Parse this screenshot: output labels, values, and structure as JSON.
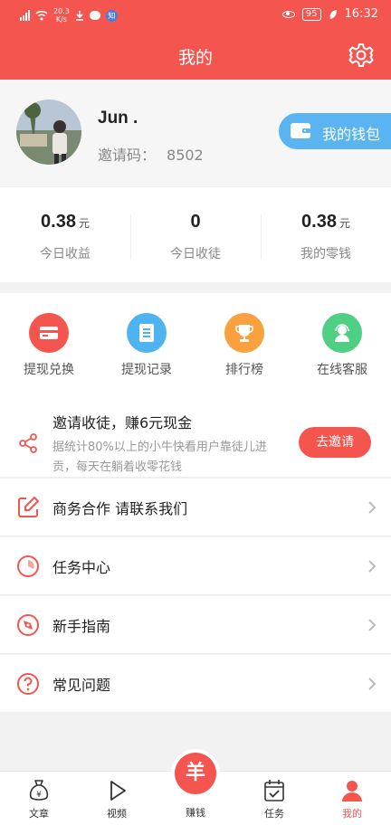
{
  "status_bar": {
    "speed_value": "20.3",
    "speed_unit": "K/s",
    "battery": "95",
    "time": "16:32"
  },
  "header": {
    "title": "我的"
  },
  "profile": {
    "name": "Jun .",
    "invite_label": "邀请码：",
    "invite_code": "8502",
    "wallet_label": "我的钱包"
  },
  "stats": [
    {
      "value": "0.38",
      "unit": "元",
      "label": "今日收益"
    },
    {
      "value": "0",
      "unit": "",
      "label": "今日收徒"
    },
    {
      "value": "0.38",
      "unit": "元",
      "label": "我的零钱"
    }
  ],
  "quick_actions": [
    {
      "label": "提现兑换",
      "color": "#f5554f",
      "icon": "card-icon"
    },
    {
      "label": "提现记录",
      "color": "#4fb3ef",
      "icon": "list-icon"
    },
    {
      "label": "排行榜",
      "color": "#f9a03f",
      "icon": "trophy-icon"
    },
    {
      "label": "在线客服",
      "color": "#4fcf84",
      "icon": "support-icon"
    }
  ],
  "invite": {
    "title": "邀请收徒，赚6元现金",
    "desc": "据统计80%以上的小牛快看用户靠徒儿进贡，每天在躺着收零花钱",
    "button": "去邀请"
  },
  "menu": [
    {
      "label": "商务合作 请联系我们",
      "icon": "edit-icon"
    },
    {
      "label": "任务中心",
      "icon": "clock-icon"
    },
    {
      "label": "新手指南",
      "icon": "compass-icon"
    },
    {
      "label": "常见问题",
      "icon": "question-icon"
    }
  ],
  "tabbar": {
    "tabs": [
      {
        "label": "文章"
      },
      {
        "label": "视频"
      },
      {
        "label": "任务"
      },
      {
        "label": "我的"
      }
    ],
    "center": {
      "glyph": "羊",
      "label": "赚钱"
    }
  },
  "colors": {
    "primary": "#f5554f",
    "wallet": "#5ab4f2"
  }
}
